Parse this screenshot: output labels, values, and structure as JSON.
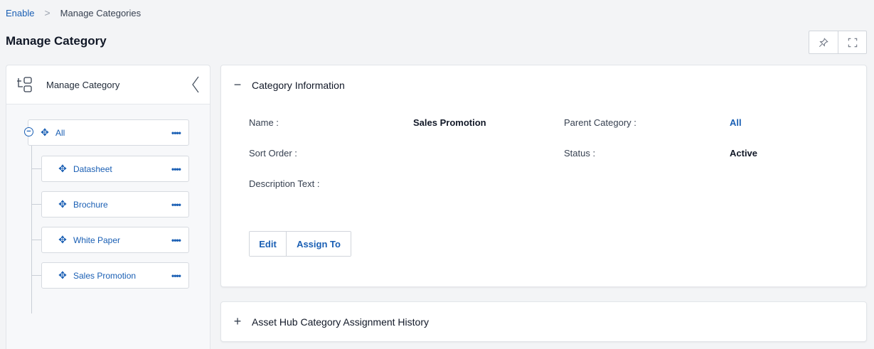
{
  "breadcrumb": {
    "root": "Enable",
    "separator": ">",
    "current": "Manage Categories"
  },
  "page": {
    "title": "Manage Category"
  },
  "toolbar": {
    "pin_icon": "pin-icon",
    "fullscreen_icon": "fullscreen-icon"
  },
  "left_panel": {
    "title": "Manage Category",
    "tree": {
      "root": {
        "label": "All",
        "expanded": true
      },
      "children": [
        {
          "label": "Datasheet"
        },
        {
          "label": "Brochure"
        },
        {
          "label": "White Paper"
        },
        {
          "label": "Sales Promotion"
        }
      ]
    }
  },
  "category_info": {
    "title": "Category Information",
    "fields": {
      "name_label": "Name :",
      "name_value": "Sales Promotion",
      "parent_label": "Parent Category :",
      "parent_value": "All",
      "sort_label": "Sort Order :",
      "status_label": "Status :",
      "status_value": "Active",
      "desc_label": "Description Text :"
    },
    "buttons": {
      "edit": "Edit",
      "assign": "Assign To"
    }
  },
  "history": {
    "title": "Asset Hub Category Assignment History"
  },
  "colors": {
    "accent": "#1a5fb4",
    "background": "#f3f4f6"
  }
}
